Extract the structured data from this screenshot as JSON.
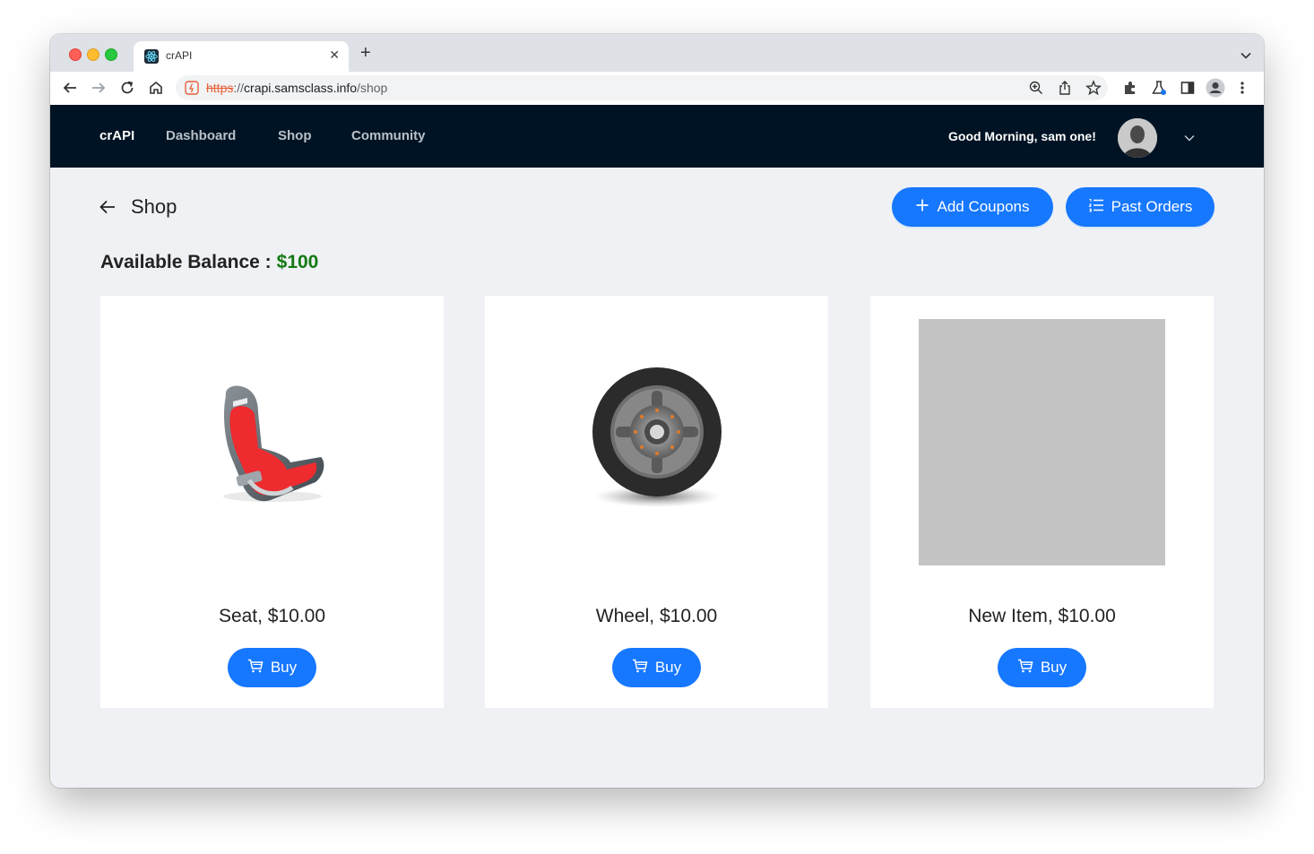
{
  "browser": {
    "tab_title": "crAPI",
    "url_scheme": "https",
    "url_sep": "://",
    "url_host": "crapi.samsclass.info",
    "url_path": "/shop"
  },
  "nav": {
    "brand": "crAPI",
    "links": [
      "Dashboard",
      "Shop",
      "Community"
    ],
    "greeting": "Good Morning, sam one!"
  },
  "page": {
    "title": "Shop",
    "add_coupons": "Add Coupons",
    "past_orders": "Past Orders",
    "balance_label": "Available Balance :",
    "balance_value": "$100"
  },
  "products": [
    {
      "caption": "Seat, $10.00",
      "buy": "Buy",
      "icon": "car-seat-image"
    },
    {
      "caption": "Wheel, $10.00",
      "buy": "Buy",
      "icon": "wheel-image"
    },
    {
      "caption": "New Item, $10.00",
      "buy": "Buy",
      "icon": "placeholder-image"
    }
  ],
  "colors": {
    "nav_bg": "#001324",
    "primary": "#1677ff",
    "balance": "#137a14"
  }
}
